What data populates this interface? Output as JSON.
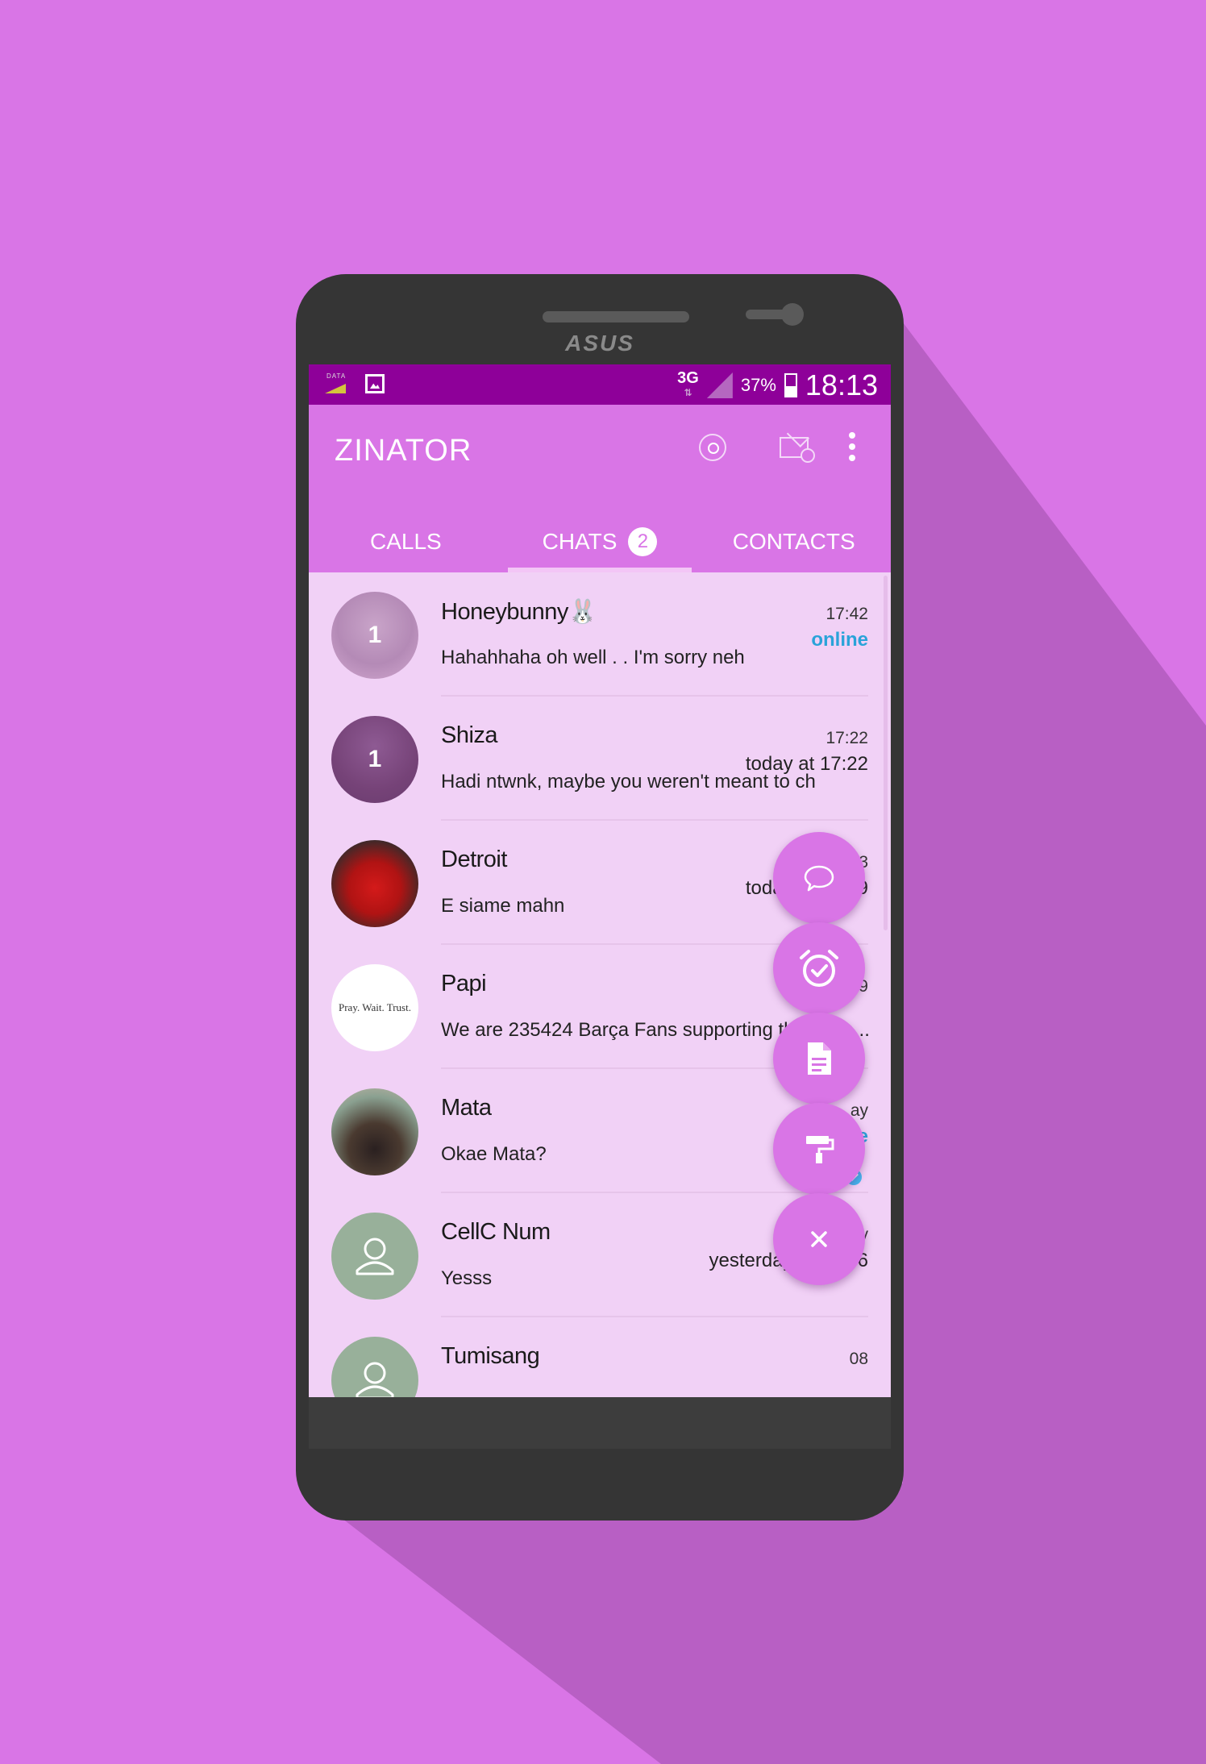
{
  "device": {
    "brand": "ASUS"
  },
  "statusbar": {
    "data_label": "DATA",
    "network": "3G",
    "battery": "37%",
    "clock": "18:13"
  },
  "appbar": {
    "title": "ZINATOR",
    "actions": [
      "search-icon",
      "new-message-icon",
      "more-vert-icon"
    ]
  },
  "tabs": [
    {
      "label": "CALLS",
      "active": false
    },
    {
      "label": "CHATS",
      "active": true,
      "badge": "2"
    },
    {
      "label": "CONTACTS",
      "active": false
    }
  ],
  "chats": [
    {
      "name": "Honeybunny🐰",
      "time": "17:42",
      "status": "online",
      "message": "Hahahhaha oh well . . I'm sorry neh",
      "unread": "1"
    },
    {
      "name": "Shiza",
      "time": "17:22",
      "status": "today at 17:22",
      "message": "Hadi ntwnk, maybe you weren't meant to ch",
      "unread": "1"
    },
    {
      "name": "Detroit",
      "time": "3:53",
      "status": "today at 18:09",
      "message": "E siame mahn"
    },
    {
      "name": "Papi",
      "time": ":39",
      "status": "",
      "message": "We are 235424 Barça Fans supporting the team ..",
      "avatar_text": "Pray. Wait. Trust."
    },
    {
      "name": "Mata",
      "time": "ay",
      "status": "online",
      "message": "Okae Mata?"
    },
    {
      "name": "CellC Num",
      "time": "ay",
      "status": "yesterday at 19:56",
      "message": "Yesss"
    },
    {
      "name": "Tumisang",
      "time": "08",
      "status": "",
      "message": ""
    }
  ],
  "fab_menu": [
    "chat-bubble-icon",
    "alarm-check-icon",
    "document-icon",
    "paint-roller-icon",
    "close-icon"
  ],
  "colors": {
    "accent": "#d975e6",
    "statusbar": "#8e0099",
    "list_bg": "#f1d1f6",
    "online": "#2aa3d9"
  }
}
